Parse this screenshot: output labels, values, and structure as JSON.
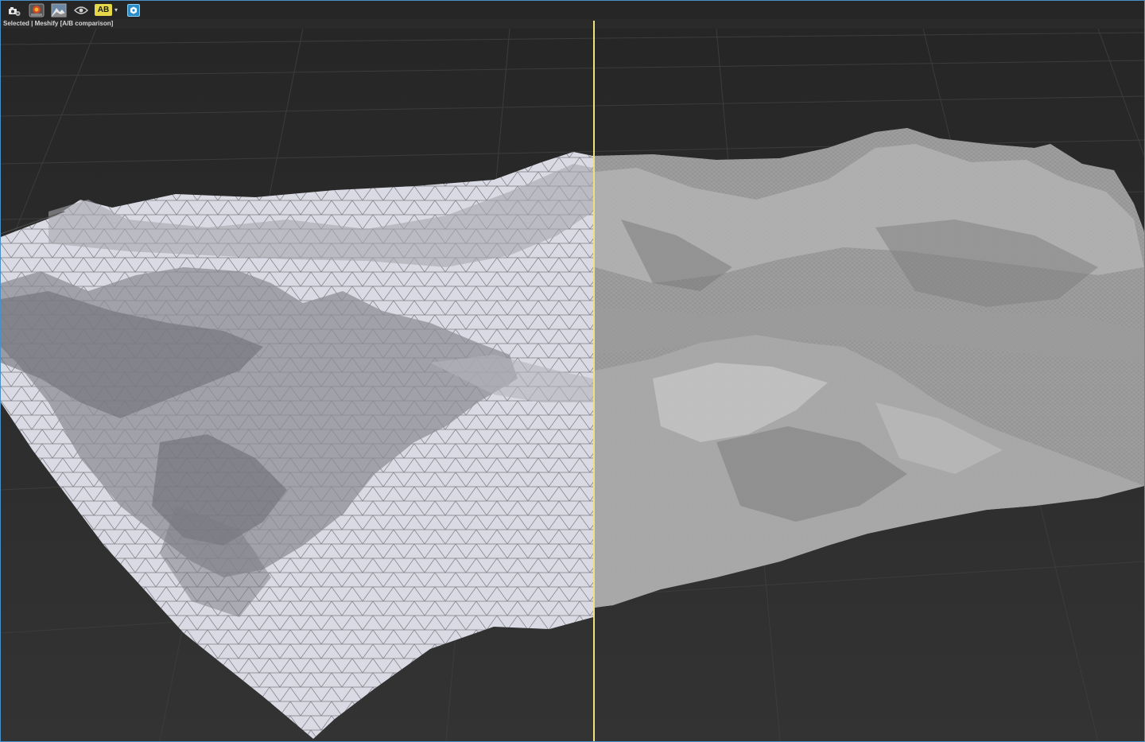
{
  "toolbar": {
    "buttons": [
      {
        "name": "camera-settings-button",
        "icon": "camera-gear-icon"
      },
      {
        "name": "render-output-button",
        "icon": "render-output-icon"
      },
      {
        "name": "terrain-view-button",
        "icon": "terrain-icon"
      },
      {
        "name": "visibility-button",
        "icon": "eye-icon"
      }
    ],
    "ab_label": "AB",
    "dropdown_glyph": "▾",
    "active_button_icon": "hexagon-icon"
  },
  "status": {
    "text": "Selected | Meshify [A/B comparison]"
  },
  "colors": {
    "divider": "#f0df7a",
    "window_border": "#4a90c8",
    "ab_badge": "#e4d84a",
    "active_button": "#2a8ec9"
  }
}
